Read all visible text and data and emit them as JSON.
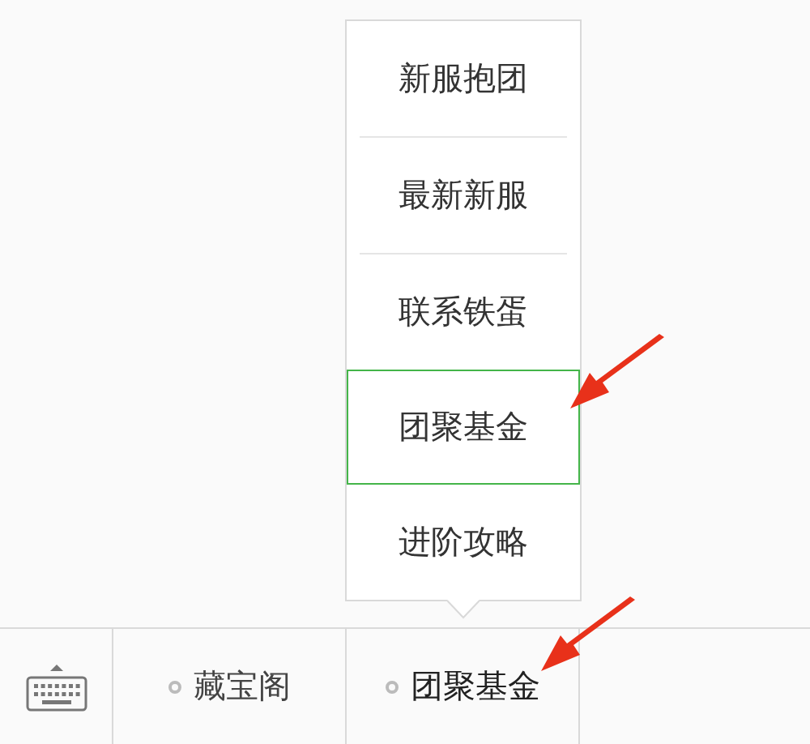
{
  "popup_menu": {
    "items": [
      {
        "label": "新服抱团",
        "selected": false
      },
      {
        "label": "最新新服",
        "selected": false
      },
      {
        "label": "联系铁蛋",
        "selected": false
      },
      {
        "label": "团聚基金",
        "selected": true
      },
      {
        "label": "进阶攻略",
        "selected": false
      }
    ]
  },
  "bottom_menu": {
    "items": [
      {
        "label": "藏宝阁",
        "selected": false
      },
      {
        "label": "团聚基金",
        "selected": true
      }
    ]
  }
}
